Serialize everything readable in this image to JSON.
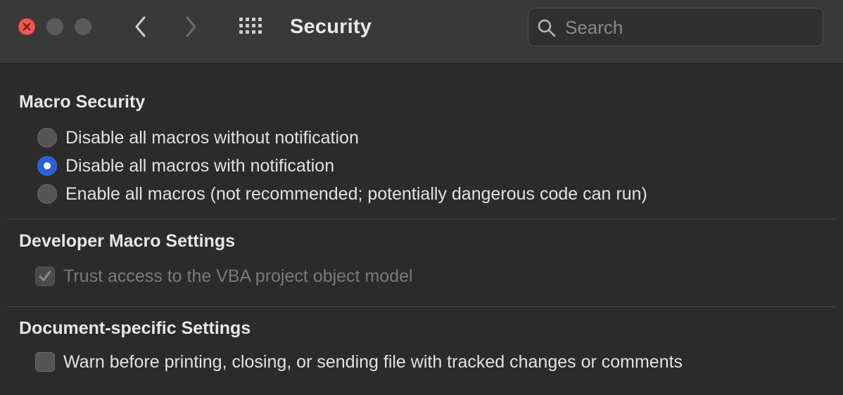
{
  "window": {
    "title": "Security"
  },
  "toolbar": {
    "back_icon": "chevron-left-icon",
    "forward_icon": "chevron-right-icon",
    "show_all_icon": "grid-icon"
  },
  "search": {
    "placeholder": "Search",
    "value": ""
  },
  "macro_security": {
    "heading": "Macro Security",
    "options": [
      {
        "label": "Disable all macros without notification",
        "selected": false
      },
      {
        "label": "Disable all macros with notification",
        "selected": true
      },
      {
        "label": "Enable all macros (not recommended; potentially dangerous code can run)",
        "selected": false
      }
    ]
  },
  "developer": {
    "heading": "Developer Macro Settings",
    "trust_vba": {
      "label": "Trust access to the VBA project object model",
      "checked": true,
      "enabled": false
    }
  },
  "document": {
    "heading": "Document-specific Settings",
    "warn_tracked": {
      "label": "Warn before printing, closing, or sending file with tracked changes or comments",
      "checked": false,
      "enabled": true
    }
  },
  "colors": {
    "accent": "#2b5fd9",
    "close": "#ee5a52",
    "background": "#2b2b2b",
    "toolbar": "#393939"
  }
}
